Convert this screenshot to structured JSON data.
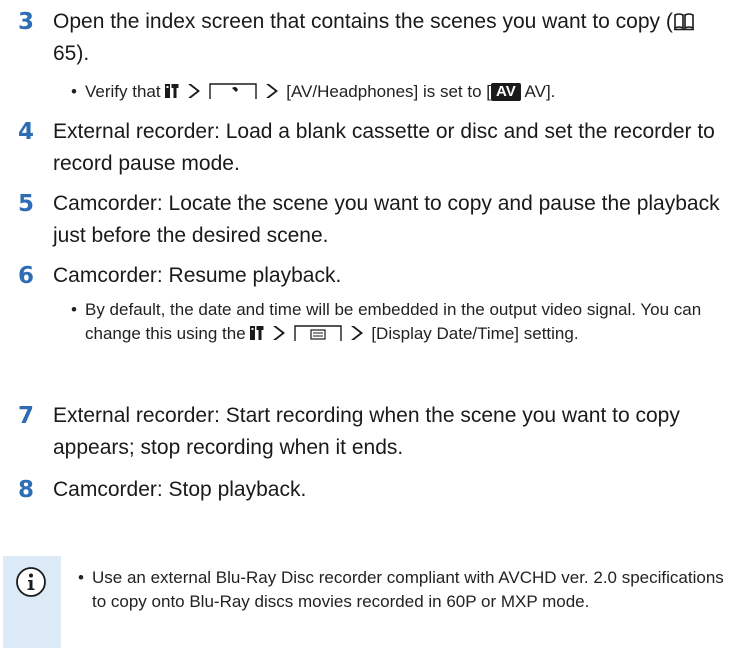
{
  "colors": {
    "step_number": "#2e6db4",
    "note_background": "#dbeaf6",
    "text": "#1a1a1a"
  },
  "steps": [
    {
      "number": "3",
      "text_a": "Open the index screen that contains the scenes you want to copy (",
      "text_b": " 65).",
      "bullet": {
        "part1": "Verify that ",
        "part2": " [AV/Headphones] is set to [",
        "av_badge": "AV",
        "part3": " AV]."
      }
    },
    {
      "number": "4",
      "text": "External recorder: Load a blank cassette or disc and set the recorder to record pause mode."
    },
    {
      "number": "5",
      "text": "Camcorder: Locate the scene you want to copy and pause the playback just before the desired scene."
    },
    {
      "number": "6",
      "text": "Camcorder: Resume playback.",
      "bullet": {
        "part1": "By default, the date and time will be embedded in the output video signal. You can change this using the ",
        "part2": " [Display Date/Time] setting."
      }
    },
    {
      "number": "7",
      "text": "External recorder: Start recording when the scene you want to copy appears; stop recording when it ends."
    },
    {
      "number": "8",
      "text": "Camcorder: Stop playback."
    }
  ],
  "note": {
    "icon": "info-icon",
    "text": "Use an external Blu-Ray Disc recorder compliant with AVCHD ver. 2.0 specifications to copy onto Blu-Ray discs movies recorded in 60P or MXP mode."
  },
  "bullet_glyph": "•"
}
